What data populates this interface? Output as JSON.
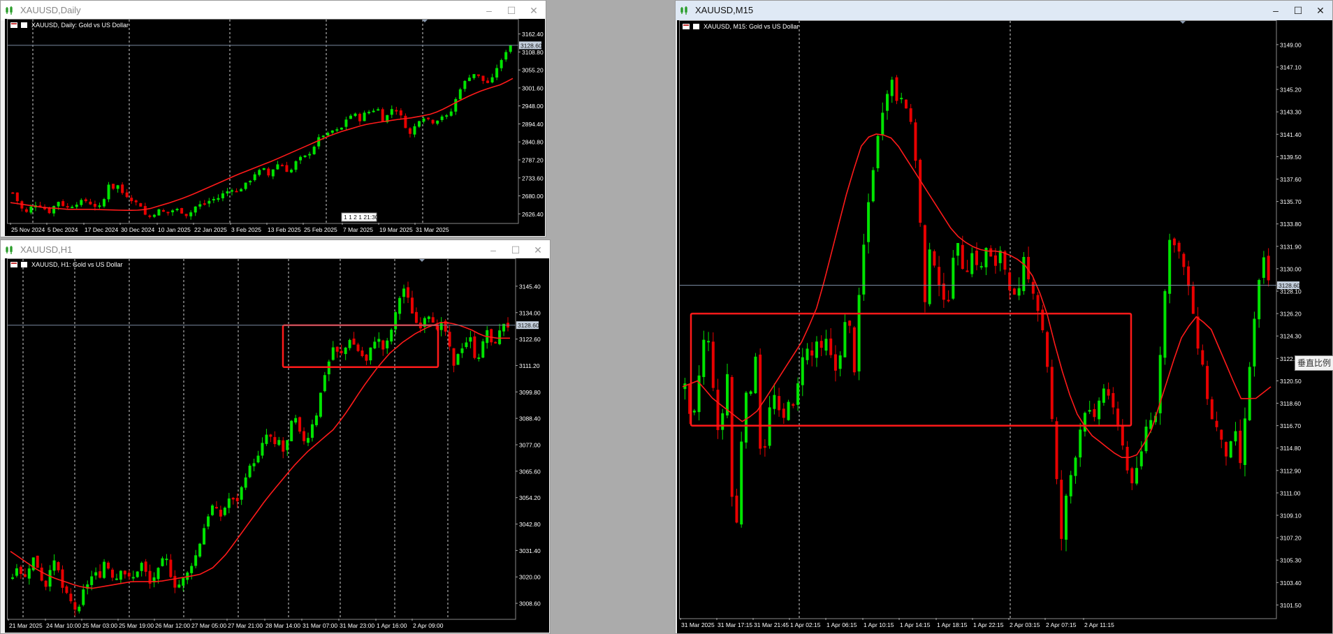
{
  "colors": {
    "bull": "#00e400",
    "bear": "#e80000",
    "ma": "#ff1a1a",
    "grid": "#cfcfcf",
    "text": "#ffffff",
    "bidline": "#7a8aa0",
    "box": "#ff1a1a",
    "bidlabel_bg": "#c4cfdd",
    "bidlabel_text": "#1a1a1a"
  },
  "tooltip": "垂直比例",
  "charts": [
    {
      "id": "daily",
      "window_title": "XAUUSD,Daily",
      "chart_title": "XAUUSD, Daily:  Gold vs US Dollar",
      "bid_label": "3128.60",
      "axis_labels": [
        "3162.40",
        "3108.80",
        "3055.20",
        "3001.60",
        "2948.00",
        "2894.40",
        "2840.80",
        "2787.20",
        "2733.60",
        "2680.00",
        "2626.40"
      ],
      "x_labels": [
        "25 Nov 2024",
        "5 Dec 2024",
        "17 Dec 2024",
        "30 Dec 2024",
        "10 Jan 2025",
        "22 Jan 2025",
        "3 Feb 2025",
        "13 Feb 2025",
        "25 Feb 2025",
        "7 Mar 2025",
        "19 Mar 2025",
        "31 Mar 2025"
      ],
      "cursor_time": "1 1 2 1 21:30"
    },
    {
      "id": "h1",
      "window_title": "XAUUSD,H1",
      "chart_title": "XAUUSD, H1:  Gold vs US Dollar",
      "bid_label": "3128.60",
      "axis_labels": [
        "3145.40",
        "3134.00",
        "3122.60",
        "3111.20",
        "3099.80",
        "3088.40",
        "3077.00",
        "3065.60",
        "3054.20",
        "3042.80",
        "3031.40",
        "3020.00",
        "3008.60"
      ],
      "x_labels": [
        "21 Mar 2025",
        "24 Mar 10:00",
        "25 Mar 03:00",
        "25 Mar 19:00",
        "26 Mar 12:00",
        "27 Mar 05:00",
        "27 Mar 21:00",
        "28 Mar 14:00",
        "31 Mar 07:00",
        "31 Mar 23:00",
        "1 Apr 16:00",
        "2 Apr 09:00"
      ]
    },
    {
      "id": "m15",
      "window_title": "XAUUSD,M15",
      "chart_title": "XAUUSD, M15:  Gold vs US Dollar",
      "bid_label": "3128.60",
      "axis_labels": [
        "3149.00",
        "3147.10",
        "3145.20",
        "3143.30",
        "3141.40",
        "3139.50",
        "3137.60",
        "3135.70",
        "3133.80",
        "3131.90",
        "3130.00",
        "3128.10",
        "3126.20",
        "3124.30",
        "3122.40",
        "3120.50",
        "3118.60",
        "3116.70",
        "3114.80",
        "3112.90",
        "3111.00",
        "3109.10",
        "3107.20",
        "3105.30",
        "3103.40",
        "3101.50"
      ],
      "x_labels": [
        "31 Mar 2025",
        "31 Mar 17:15",
        "31 Mar 21:45",
        "1 Apr 02:15",
        "1 Apr 06:15",
        "1 Apr 10:15",
        "1 Apr 14:15",
        "1 Apr 18:15",
        "1 Apr 22:15",
        "2 Apr 03:15",
        "2 Apr 07:15",
        "2 Apr 11:15"
      ]
    }
  ],
  "chart_data": [
    {
      "type": "candlestick",
      "title": "XAUUSD, Daily:  Gold vs US Dollar",
      "ylim": [
        2600,
        3170
      ],
      "x_ticks": [
        "25 Nov 2024",
        "5 Dec 2024",
        "17 Dec 2024",
        "30 Dec 2024",
        "10 Jan 2025",
        "22 Jan 2025",
        "3 Feb 2025",
        "13 Feb 2025",
        "25 Feb 2025",
        "7 Mar 2025",
        "19 Mar 2025",
        "31 Mar 2025"
      ],
      "close_points": [
        2690,
        2664,
        2640,
        2630,
        2650,
        2655,
        2648,
        2638,
        2628,
        2660,
        2665,
        2643,
        2648,
        2652,
        2662,
        2668,
        2660,
        2650,
        2647,
        2652,
        2720,
        2700,
        2715,
        2690,
        2680,
        2668,
        2660,
        2650,
        2622,
        2618,
        2628,
        2640,
        2630,
        2630,
        2640,
        2640,
        2625,
        2620,
        2640,
        2655,
        2653,
        2660,
        2672,
        2668,
        2685,
        2690,
        2703,
        2690,
        2700,
        2715,
        2725,
        2745,
        2755,
        2760,
        2740,
        2762,
        2776,
        2770,
        2750,
        2760,
        2790,
        2795,
        2800,
        2812,
        2840,
        2862,
        2860,
        2870,
        2880,
        2870,
        2905,
        2915,
        2930,
        2900,
        2925,
        2930,
        2935,
        2940,
        2905,
        2920,
        2940,
        2935,
        2915,
        2880,
        2860,
        2895,
        2910,
        2915,
        2905,
        2895,
        2915,
        2920,
        2915,
        2950,
        2990,
        3015,
        3030,
        3045,
        3040,
        3025,
        3015,
        3025,
        3060,
        3080,
        3110,
        3130
      ],
      "ma_points": [
        2660,
        2655,
        2650,
        2645,
        2643,
        2640,
        2640,
        2640,
        2639,
        2638,
        2637,
        2637,
        2640,
        2650,
        2660,
        2672,
        2685,
        2700,
        2715,
        2730,
        2745,
        2758,
        2772,
        2785,
        2800,
        2815,
        2830,
        2845,
        2860,
        2872,
        2882,
        2892,
        2898,
        2903,
        2908,
        2912,
        2918,
        2925,
        2940,
        2958,
        2975,
        2990,
        3002,
        3012,
        3030
      ],
      "bid": 3128.6
    },
    {
      "type": "candlestick",
      "title": "XAUUSD, H1:  Gold vs US Dollar",
      "ylim": [
        3002,
        3152
      ],
      "x_ticks": [
        "21 Mar 2025",
        "24 Mar 10:00",
        "25 Mar 03:00",
        "25 Mar 19:00",
        "26 Mar 12:00",
        "27 Mar 05:00",
        "27 Mar 21:00",
        "28 Mar 14:00",
        "31 Mar 07:00",
        "31 Mar 23:00",
        "1 Apr 16:00",
        "2 Apr 09:00"
      ],
      "close_points": [
        3020,
        3026,
        3018,
        3024,
        3029,
        3021,
        3015,
        3025,
        3027,
        3016,
        3012,
        3008,
        3004,
        3014,
        3018,
        3022,
        3020,
        3028,
        3021,
        3019,
        3024,
        3020,
        3019,
        3023,
        3027,
        3016,
        3020,
        3024,
        3030,
        3021,
        3015,
        3018,
        3021,
        3026,
        3031,
        3040,
        3047,
        3052,
        3045,
        3050,
        3055,
        3051,
        3058,
        3065,
        3069,
        3071,
        3078,
        3083,
        3076,
        3079,
        3072,
        3086,
        3088,
        3080,
        3078,
        3086,
        3091,
        3105,
        3112,
        3120,
        3115,
        3118,
        3123,
        3119,
        3116,
        3113,
        3120,
        3124,
        3118,
        3122,
        3130,
        3140,
        3145,
        3137,
        3130,
        3128,
        3134,
        3132,
        3126,
        3130,
        3122,
        3110,
        3118,
        3120,
        3124,
        3114,
        3116,
        3128,
        3120,
        3122,
        3130,
        3128
      ],
      "ma_points": [
        3031,
        3027,
        3023,
        3020,
        3018,
        3016,
        3015,
        3016,
        3017,
        3018,
        3018,
        3018,
        3019,
        3020,
        3021,
        3024,
        3030,
        3038,
        3046,
        3054,
        3061,
        3068,
        3074,
        3079,
        3084,
        3092,
        3101,
        3109,
        3116,
        3121,
        3125,
        3128,
        3130,
        3129,
        3127,
        3124,
        3123,
        3123
      ],
      "box": {
        "y_top": 3128.6,
        "y_bottom": 3110.5
      },
      "bid": 3128.6
    },
    {
      "type": "candlestick",
      "title": "XAUUSD, M15:  Gold vs US Dollar",
      "ylim": [
        3100.4,
        3150.0
      ],
      "x_ticks": [
        "31 Mar 2025",
        "31 Mar 17:15",
        "31 Mar 21:45",
        "1 Apr 02:15",
        "1 Apr 06:15",
        "1 Apr 10:15",
        "1 Apr 14:15",
        "1 Apr 18:15",
        "1 Apr 22:15",
        "2 Apr 03:15",
        "2 Apr 07:15",
        "2 Apr 11:15"
      ],
      "close_points": [
        3120,
        3117,
        3118,
        3123,
        3125,
        3121,
        3116,
        3118,
        3122,
        3104,
        3113,
        3120,
        3119,
        3123,
        3113,
        3116,
        3120,
        3118,
        3117,
        3119,
        3118,
        3121,
        3124,
        3122,
        3124,
        3123,
        3124,
        3122,
        3121,
        3125,
        3126,
        3121,
        3128,
        3133,
        3137,
        3140,
        3143,
        3145,
        3146,
        3144,
        3145,
        3143,
        3141,
        3135,
        3127,
        3132,
        3130,
        3128,
        3126,
        3131,
        3132,
        3130,
        3130,
        3132,
        3129,
        3132,
        3131,
        3130,
        3132,
        3129,
        3128,
        3127,
        3131,
        3129,
        3128,
        3126,
        3124,
        3119,
        3113,
        3107,
        3111,
        3113,
        3115,
        3118,
        3118,
        3117,
        3119,
        3120,
        3119,
        3117,
        3116,
        3113,
        3112,
        3113,
        3115,
        3118,
        3116,
        3122,
        3128,
        3133,
        3132,
        3131,
        3129,
        3127,
        3123,
        3122,
        3118,
        3117,
        3116,
        3114,
        3115,
        3116,
        3113,
        3119,
        3124,
        3128,
        3131,
        3129
      ],
      "ma_points": [
        3120,
        3120.5,
        3119,
        3118,
        3117,
        3118,
        3120,
        3122,
        3124,
        3127,
        3132,
        3137,
        3141,
        3141.5,
        3141,
        3139,
        3137,
        3135,
        3133,
        3132,
        3131.5,
        3131.5,
        3131,
        3130,
        3127,
        3122,
        3118,
        3116,
        3115,
        3114,
        3114,
        3116,
        3120,
        3124,
        3126,
        3125,
        3122,
        3119,
        3119,
        3120
      ],
      "box": {
        "y_top": 3126.2,
        "y_bottom": 3116.7
      },
      "bid": 3128.6
    }
  ]
}
